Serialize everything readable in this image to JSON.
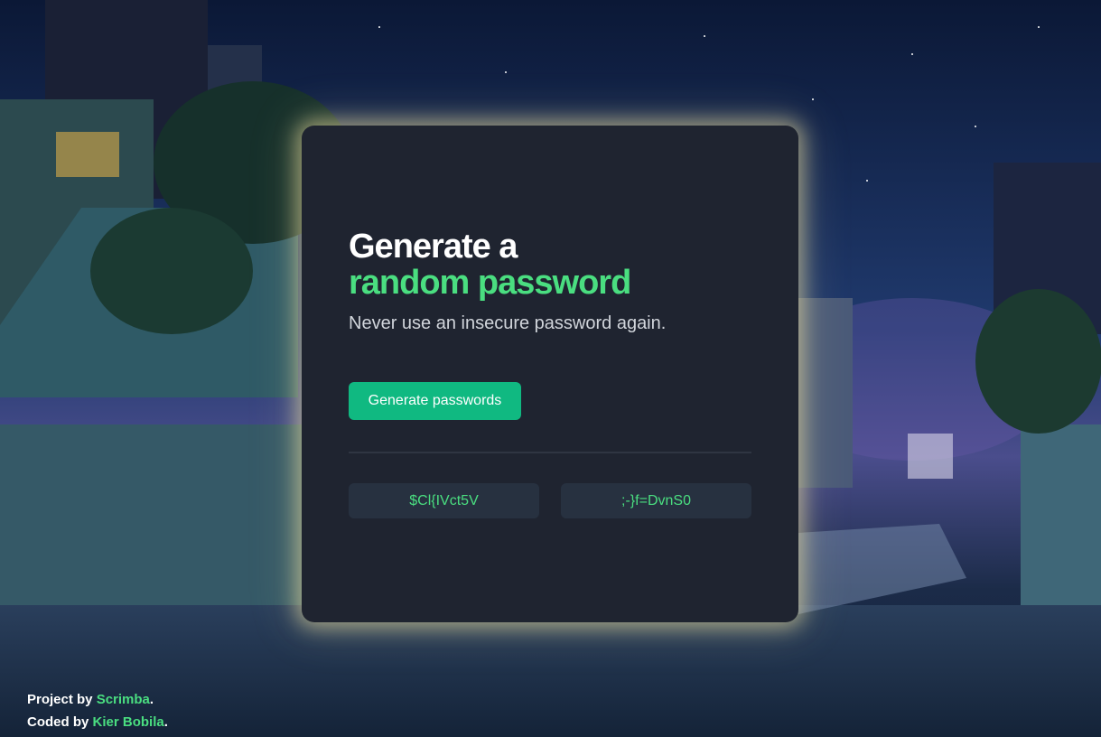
{
  "card": {
    "title_line1": "Generate a",
    "title_line2": "random password",
    "subtitle": "Never use an insecure password again.",
    "generate_button": "Generate passwords",
    "passwords": [
      "$Cl{IVct5V",
      ";-}f=DvnS0"
    ]
  },
  "footer": {
    "project_prefix": "Project by ",
    "project_link": "Scrimba",
    "project_suffix": ".",
    "coded_prefix": "Coded by ",
    "coded_link": "Kier Bobila",
    "coded_suffix": "."
  },
  "colors": {
    "accent": "#4ade80",
    "button": "#10b981",
    "card_bg": "#1f2430",
    "password_bg": "#273140",
    "glow": "#f0e2a0"
  }
}
